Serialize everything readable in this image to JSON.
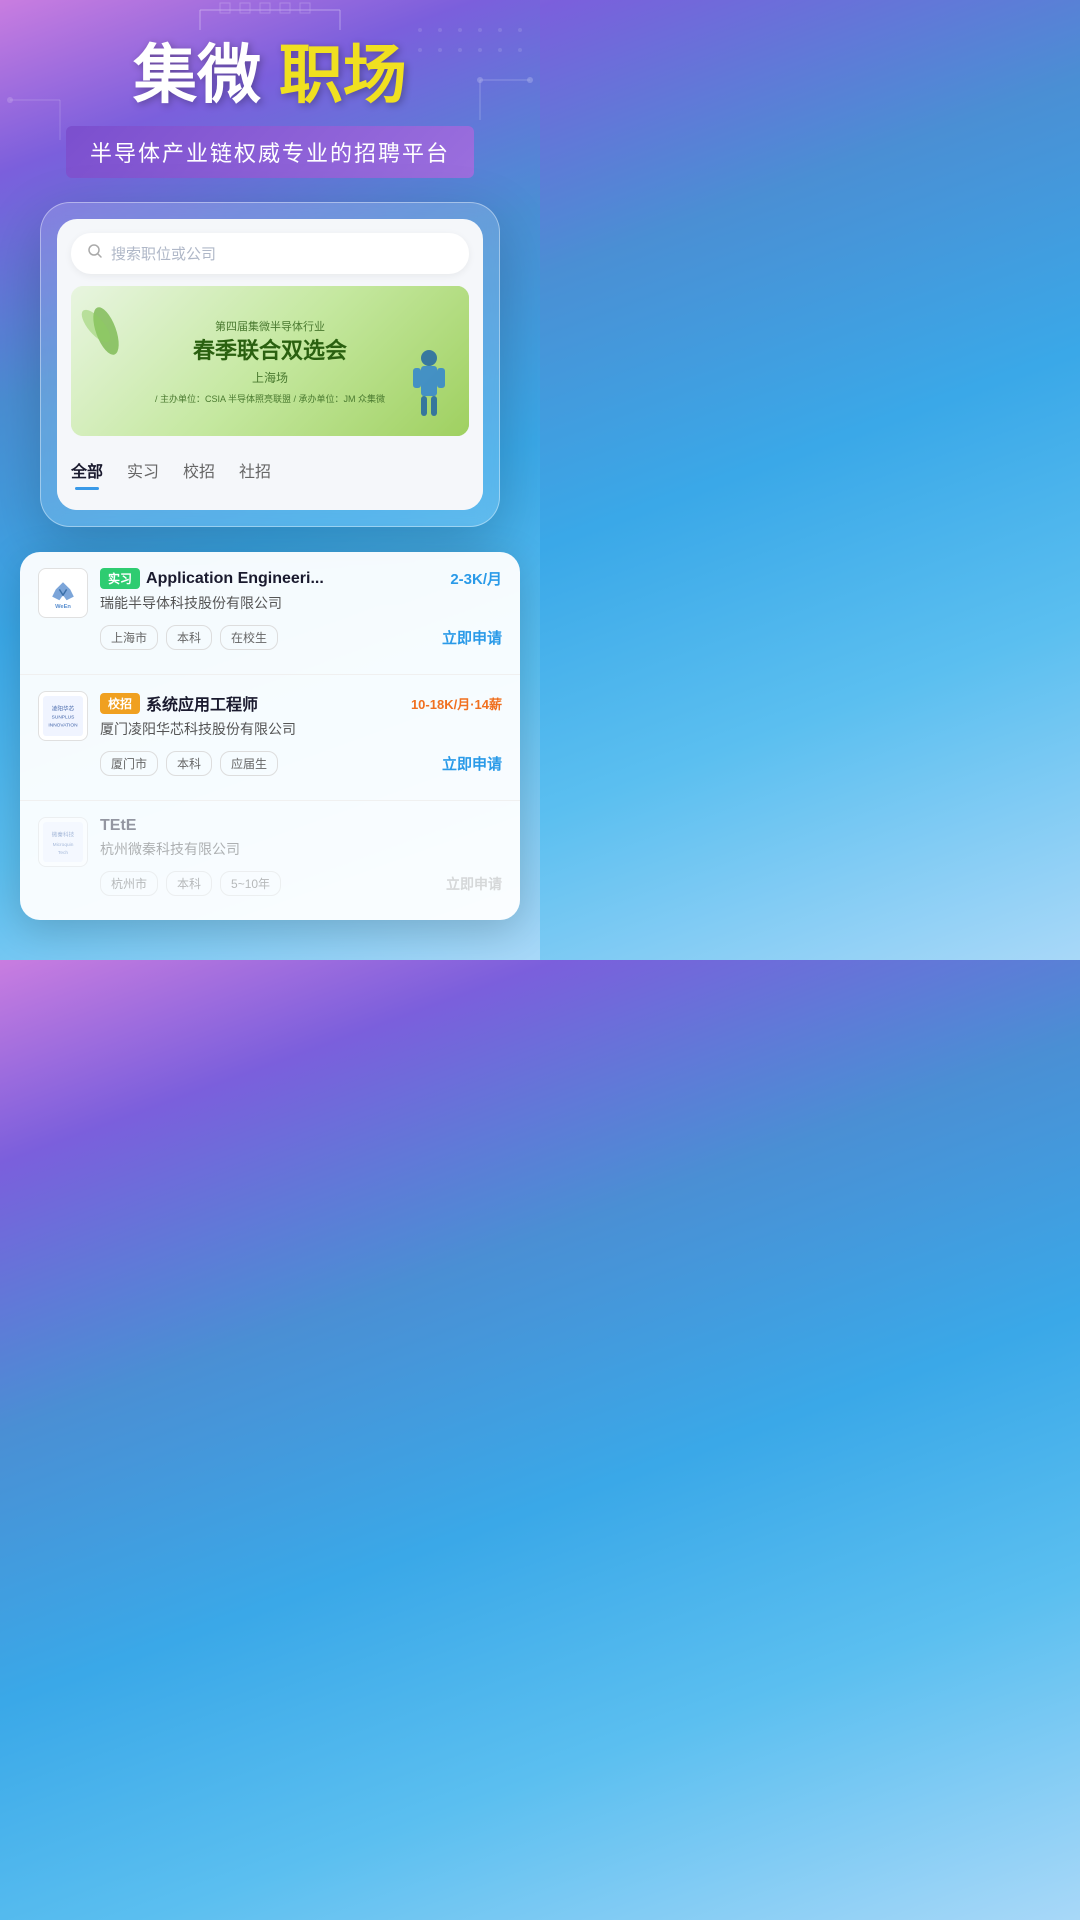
{
  "app": {
    "title": "集微职场",
    "title_white": "集微",
    "title_yellow": "职场",
    "subtitle": "半导体产业链权威专业的招聘平台"
  },
  "search": {
    "placeholder": "搜索职位或公司"
  },
  "banner": {
    "event_label": "第四届集微半导体行业",
    "event_title_line1": "春季联合双选会",
    "event_title_line2": "",
    "event_location": "上海场",
    "organizer": "/ 主办单位：CSIA 半导体照亮联盟 / 承办单位：JM 众集微"
  },
  "tabs": [
    {
      "label": "全部",
      "active": true
    },
    {
      "label": "实习",
      "active": false
    },
    {
      "label": "校招",
      "active": false
    },
    {
      "label": "社招",
      "active": false
    }
  ],
  "jobs": [
    {
      "id": 1,
      "badge": "实习",
      "badge_type": "internship",
      "title": "Application Engineeri...",
      "salary": "2-3K/月",
      "salary_color": "blue",
      "company": "瑞能半导体科技股份有限公司",
      "company_logo": "ween",
      "tags": [
        "上海市",
        "本科",
        "在校生"
      ],
      "apply_label": "立即申请",
      "apply_active": true
    },
    {
      "id": 2,
      "badge": "校招",
      "badge_type": "campus",
      "title": "系统应用工程师",
      "salary": "10-18K/月·14薪",
      "salary_color": "orange",
      "company": "厦门凌阳华芯科技股份有限公司",
      "company_logo": "lingyang",
      "tags": [
        "厦门市",
        "本科",
        "应届生"
      ],
      "apply_label": "立即申请",
      "apply_active": true
    },
    {
      "id": 3,
      "badge": "",
      "badge_type": "",
      "title": "TEtE",
      "salary": "",
      "salary_color": "",
      "company": "杭州微秦科技有限公司",
      "company_logo": "microquin",
      "tags": [
        "杭州市",
        "本科",
        "5~10年"
      ],
      "apply_label": "立即申请",
      "apply_active": false
    }
  ]
}
